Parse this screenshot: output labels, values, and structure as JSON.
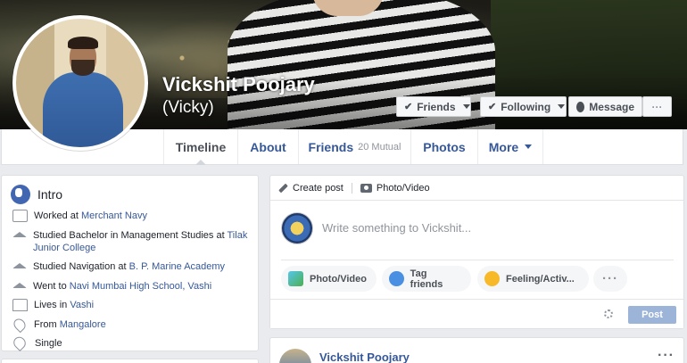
{
  "profile": {
    "name": "Vickshit Poojary",
    "alternate_name": "(Vicky)"
  },
  "cover_actions": {
    "friends": "Friends",
    "following": "Following",
    "message": "Message",
    "more": "···"
  },
  "nav": {
    "timeline": "Timeline",
    "about": "About",
    "friends": "Friends",
    "mutual": "20 Mutual",
    "photos": "Photos",
    "more": "More"
  },
  "intro": {
    "title": "Intro",
    "items": [
      {
        "prefix": "Worked at ",
        "link": "Merchant Navy",
        "icon": "briefcase-icon"
      },
      {
        "prefix": "Studied Bachelor in Management Studies at ",
        "link": "Tilak Junior College",
        "icon": "graduation-cap-icon"
      },
      {
        "prefix": "Studied Navigation at ",
        "link": "B. P. Marine Academy",
        "icon": "graduation-cap-icon"
      },
      {
        "prefix": "Went to ",
        "link": "Navi Mumbai High School, Vashi",
        "icon": "graduation-cap-icon"
      },
      {
        "prefix": "Lives in ",
        "link": "Vashi",
        "icon": "home-icon"
      },
      {
        "prefix": "From ",
        "link": "Mangalore",
        "icon": "location-pin-icon"
      },
      {
        "prefix": "Single",
        "link": "",
        "icon": "heart-icon"
      }
    ]
  },
  "composer": {
    "create_post": "Create post",
    "photo_video_tab": "Photo/Video",
    "placeholder": "Write something to Vickshit...",
    "photo_video": "Photo/Video",
    "tag_friends": "Tag friends",
    "feeling": "Feeling/Activ...",
    "more": "···",
    "post": "Post"
  },
  "feed": {
    "author": "Vickshit Poojary",
    "options": "···"
  },
  "colors": {
    "link": "#365899",
    "accent": "#4267b2",
    "background": "#e9ebee"
  }
}
